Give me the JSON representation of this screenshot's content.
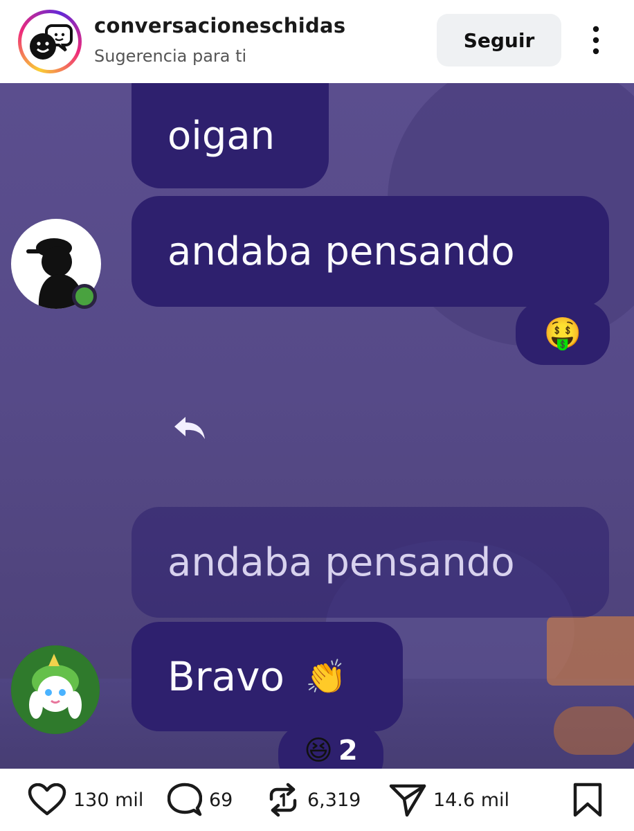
{
  "header": {
    "username": "conversacioneschidas",
    "subtitle": "Sugerencia para ti",
    "follow_label": "Seguir",
    "avatar_icon": "chat-faces-icon",
    "more_icon": "more-vertical-icon"
  },
  "post": {
    "messages": [
      {
        "text": "oigan"
      },
      {
        "text": "andaba pensando"
      },
      {
        "text": "andaba pensando",
        "style": "quoted-reply"
      },
      {
        "text": "Bravo",
        "emoji": "👏"
      }
    ],
    "reactions": [
      {
        "emoji": "🤑",
        "count": ""
      },
      {
        "emoji": "😆",
        "count": "2"
      }
    ],
    "reply_icon": "reply-arrow-icon"
  },
  "actions": {
    "likes": "130 mil",
    "comments": "69",
    "reposts": "6,319",
    "shares": "14.6 mil",
    "icons": [
      "heart-icon",
      "comment-icon",
      "repost-icon",
      "send-icon",
      "bookmark-icon"
    ]
  },
  "colors": {
    "bubble": "#2e206e",
    "chat_background": "#564a88",
    "follow_button": "#eff1f3"
  }
}
